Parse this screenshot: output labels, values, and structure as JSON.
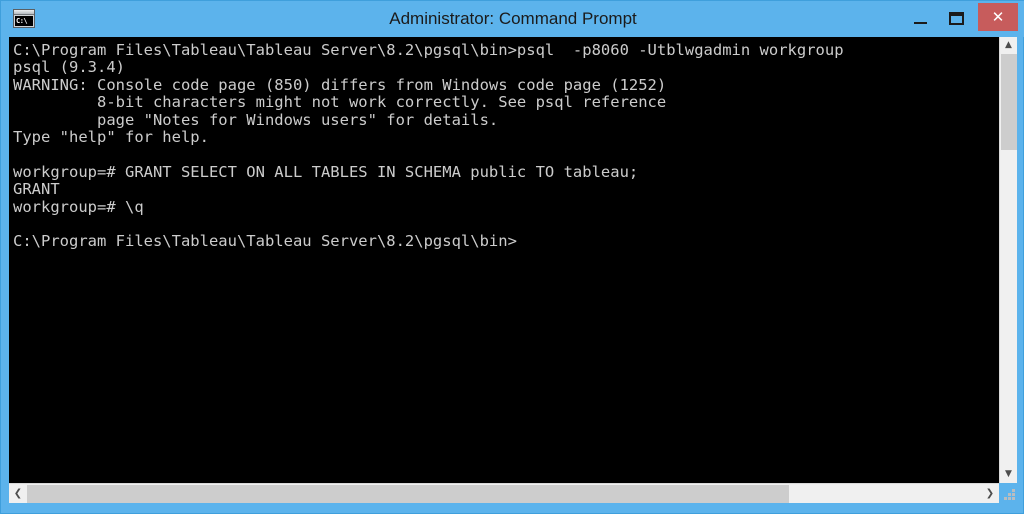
{
  "window": {
    "title": "Administrator: Command Prompt",
    "system_icon": "command-prompt-icon",
    "system_icon_text": "C:\\",
    "accent_color": "#5cb3ec",
    "close_button_color": "#c75c5c",
    "console_background": "#000000",
    "console_foreground": "#cccccc",
    "controls": {
      "minimize_label": "–",
      "maximize_label": "❐",
      "close_label": "✕"
    }
  },
  "console": {
    "lines": [
      "C:\\Program Files\\Tableau\\Tableau Server\\8.2\\pgsql\\bin>psql  -p8060 -Utblwgadmin workgroup",
      "psql (9.3.4)",
      "WARNING: Console code page (850) differs from Windows code page (1252)",
      "         8-bit characters might not work correctly. See psql reference",
      "         page \"Notes for Windows users\" for details.",
      "Type \"help\" for help.",
      "",
      "workgroup=# GRANT SELECT ON ALL TABLES IN SCHEMA public TO tableau;",
      "GRANT",
      "workgroup=# \\q",
      "",
      "C:\\Program Files\\Tableau\\Tableau Server\\8.2\\pgsql\\bin>"
    ],
    "text": "C:\\Program Files\\Tableau\\Tableau Server\\8.2\\pgsql\\bin>psql  -p8060 -Utblwgadmin workgroup\npsql (9.3.4)\nWARNING: Console code page (850) differs from Windows code page (1252)\n         8-bit characters might not work correctly. See psql reference\n         page \"Notes for Windows users\" for details.\nType \"help\" for help.\n\nworkgroup=# GRANT SELECT ON ALL TABLES IN SCHEMA public TO tableau;\nGRANT\nworkgroup=# \\q\n\nC:\\Program Files\\Tableau\\Tableau Server\\8.2\\pgsql\\bin>"
  },
  "scrollbars": {
    "vertical": {
      "up_arrow": "▲",
      "down_arrow": "▼"
    },
    "horizontal": {
      "left_arrow": "❮",
      "right_arrow": "❯"
    }
  }
}
